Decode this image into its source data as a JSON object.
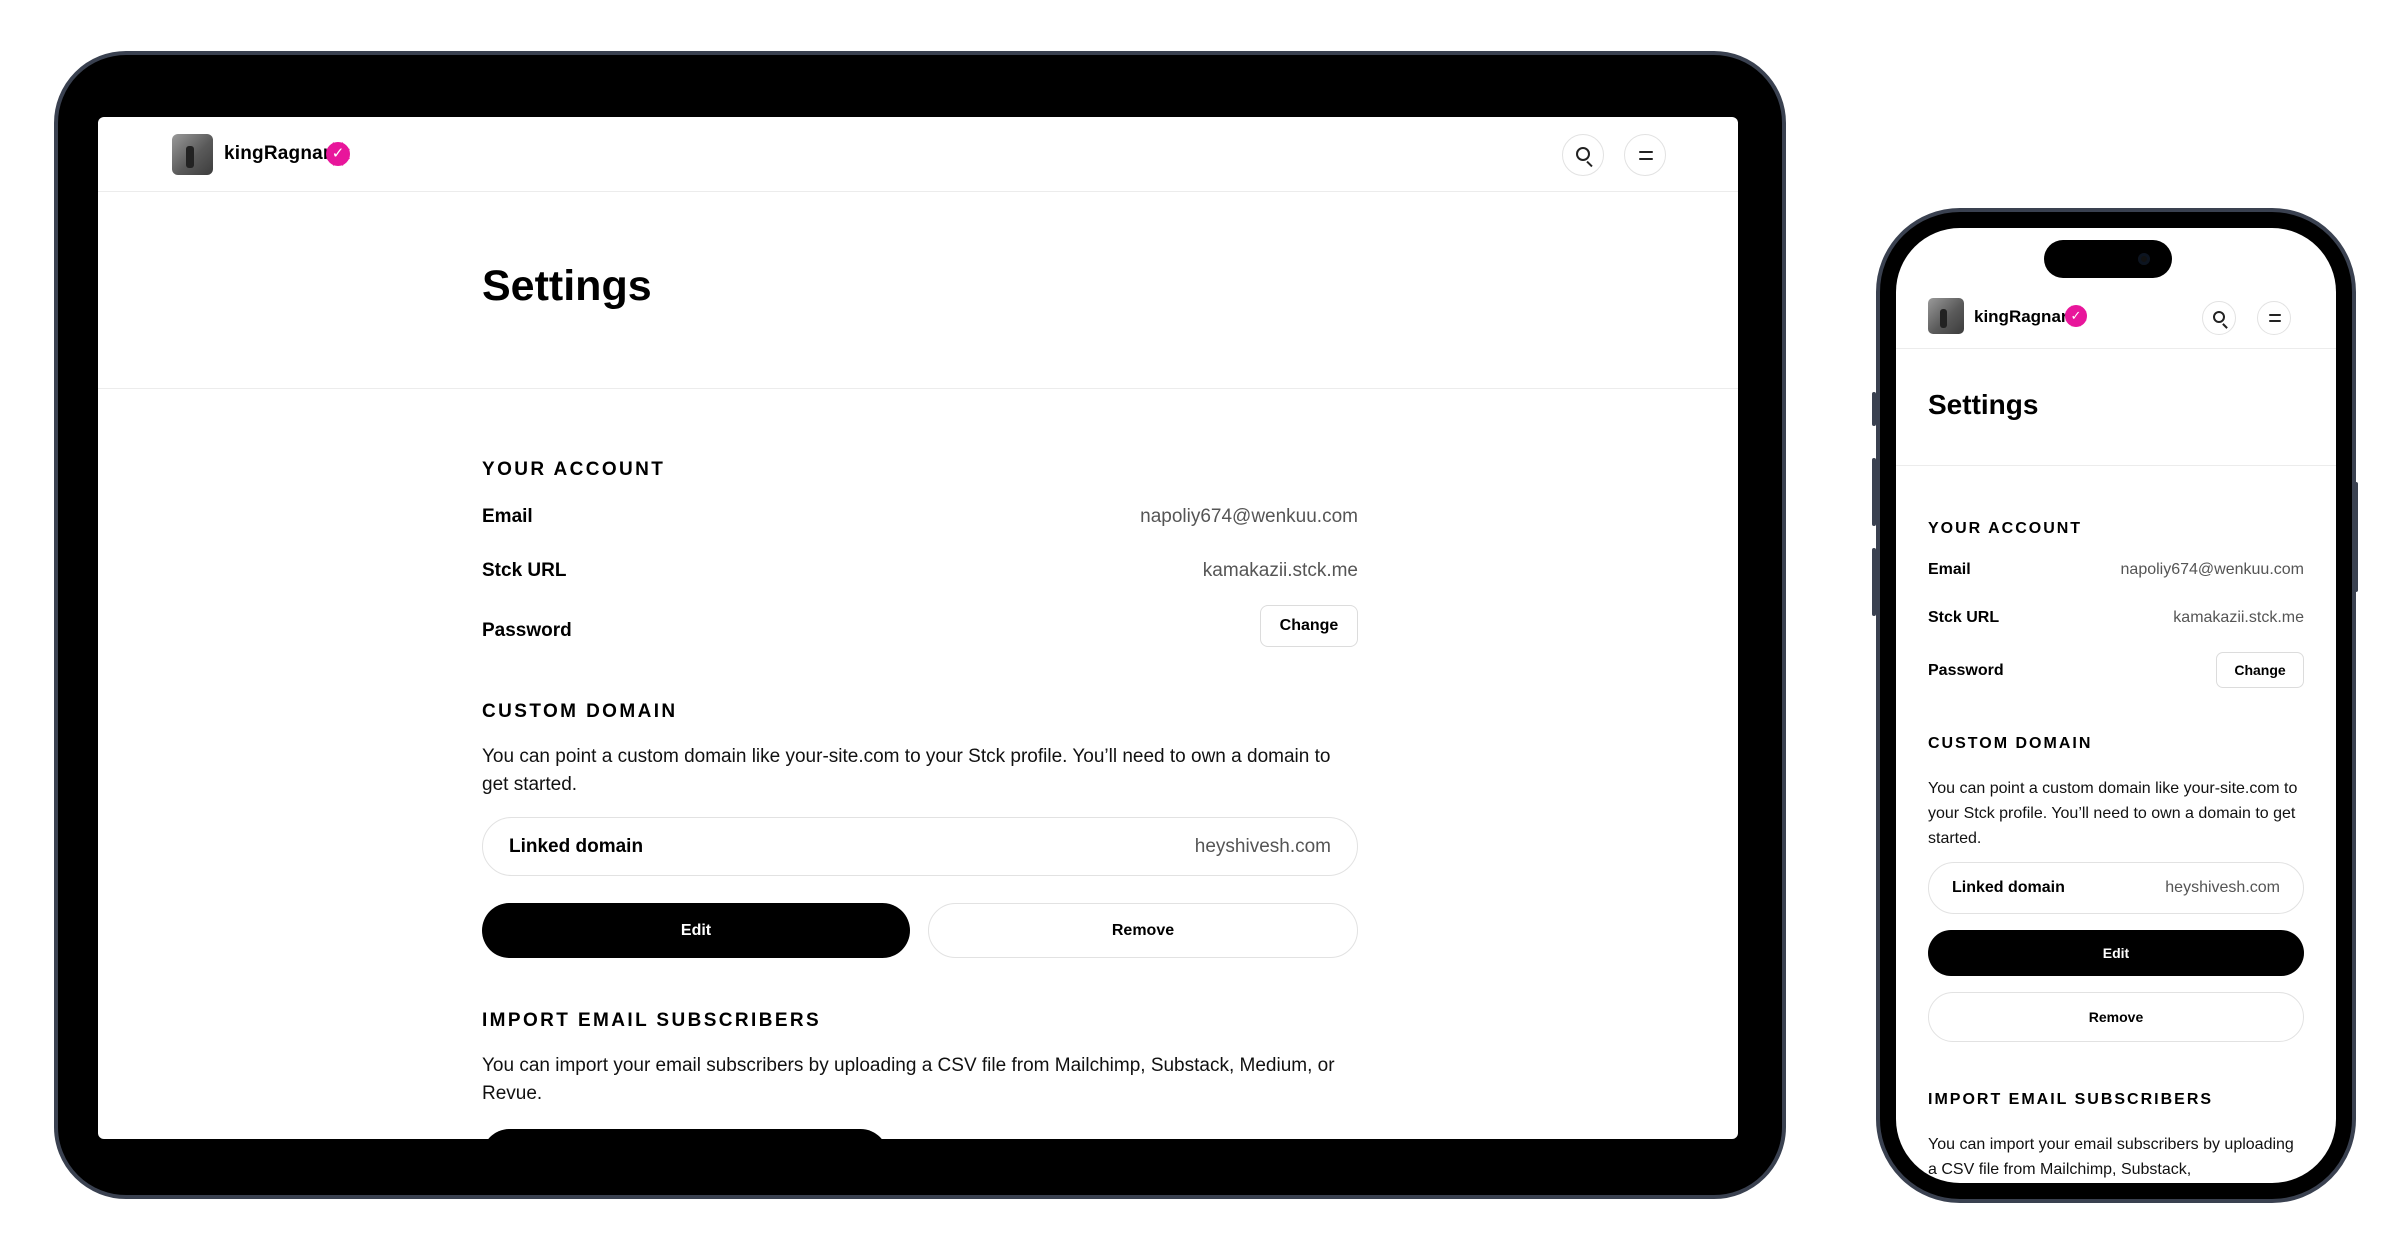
{
  "user": {
    "username": "kingRagnar",
    "avatar_icon": "avatar-photo",
    "verified_icon": "verified-badge-icon",
    "badge_color": "#e8169b"
  },
  "header": {
    "search_icon": "search-icon",
    "menu_icon": "menu-icon"
  },
  "page": {
    "title": "Settings"
  },
  "account": {
    "heading": "YOUR ACCOUNT",
    "email_label": "Email",
    "email_value": "napoliy674@wenkuu.com",
    "url_label": "Stck URL",
    "url_value": "kamakazii.stck.me",
    "password_label": "Password",
    "change_label": "Change"
  },
  "custom_domain": {
    "heading": "CUSTOM DOMAIN",
    "description": "You can point a custom domain like your-site.com to your Stck profile. You’ll need to own a domain to get started.",
    "linked_label": "Linked domain",
    "linked_value": "heyshivesh.com",
    "edit_label": "Edit",
    "remove_label": "Remove"
  },
  "import": {
    "heading": "IMPORT EMAIL SUBSCRIBERS",
    "description": "You can import your email subscribers by uploading a CSV file from Mailchimp, Substack, Medium, or Revue.",
    "phone_description": "You can import your email subscribers by uploading a CSV file from Mailchimp, Substack,"
  }
}
